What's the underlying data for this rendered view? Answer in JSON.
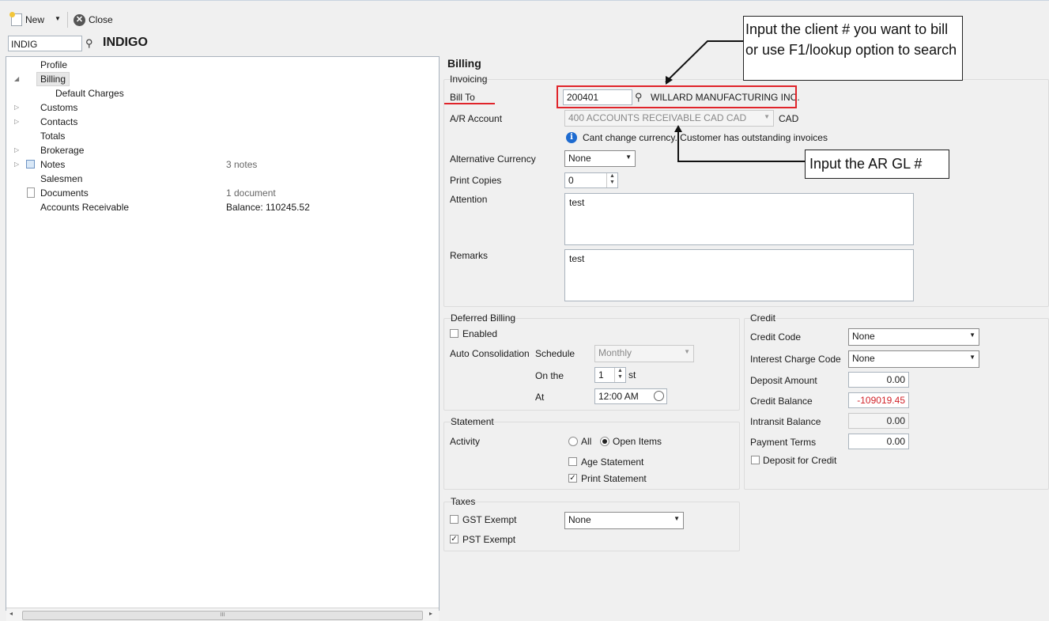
{
  "toolbar": {
    "new_label": "New",
    "close_label": "Close"
  },
  "search": {
    "value": "INDIG"
  },
  "record_title": "INDIGO",
  "tree": {
    "items": [
      {
        "label": "Profile",
        "value": ""
      },
      {
        "label": "Billing",
        "value": ""
      },
      {
        "label": "Default Charges",
        "value": ""
      },
      {
        "label": "Customs",
        "value": ""
      },
      {
        "label": "Contacts",
        "value": ""
      },
      {
        "label": "Totals",
        "value": ""
      },
      {
        "label": "Brokerage",
        "value": ""
      },
      {
        "label": "Notes",
        "value": "3 notes"
      },
      {
        "label": "Salesmen",
        "value": ""
      },
      {
        "label": "Documents",
        "value": "1 document"
      },
      {
        "label": "Accounts Receivable",
        "value": "Balance: 110245.52"
      }
    ]
  },
  "billing": {
    "heading": "Billing",
    "invoicing": {
      "title": "Invoicing",
      "bill_to_label": "Bill To",
      "bill_to_value": "200401",
      "bill_to_name": "WILLARD MANUFACTURING INC.",
      "ar_account_label": "A/R Account",
      "ar_account_value": "400 ACCOUNTS RECEIVABLE CAD CAD",
      "ar_currency": "CAD",
      "info_message": "Cant change currency. Customer has outstanding invoices",
      "alt_currency_label": "Alternative Currency",
      "alt_currency_value": "None",
      "print_copies_label": "Print Copies",
      "print_copies_value": "0",
      "attention_label": "Attention",
      "attention_value": "test",
      "remarks_label": "Remarks",
      "remarks_value": "test"
    },
    "deferred": {
      "title": "Deferred Billing",
      "enabled_label": "Enabled",
      "auto_label": "Auto Consolidation",
      "schedule_label": "Schedule",
      "schedule_value": "Monthly",
      "on_the_label": "On the",
      "on_the_value": "1",
      "on_the_suffix": "st",
      "at_label": "At",
      "at_value": "12:00 AM"
    },
    "statement": {
      "title": "Statement",
      "activity_label": "Activity",
      "all_label": "All",
      "open_items_label": "Open Items",
      "age_label": "Age Statement",
      "print_label": "Print Statement"
    },
    "taxes": {
      "title": "Taxes",
      "gst_label": "GST Exempt",
      "gst_value": "None",
      "pst_label": "PST Exempt"
    },
    "credit": {
      "title": "Credit",
      "credit_code_label": "Credit Code",
      "credit_code_value": "None",
      "interest_label": "Interest Charge Code",
      "interest_value": "None",
      "deposit_label": "Deposit Amount",
      "deposit_value": "0.00",
      "balance_label": "Credit Balance",
      "balance_value": "-109019.45",
      "intransit_label": "Intransit Balance",
      "intransit_value": "0.00",
      "terms_label": "Payment Terms",
      "terms_value": "0.00",
      "deposit_credit_label": "Deposit for Credit"
    }
  },
  "annotations": {
    "callout_client": "Input the client # you want to bill or use F1/lookup option to search",
    "callout_ar": "Input the AR GL #"
  },
  "colors": {
    "highlight_red": "#e0242a",
    "negative_red": "#d2232a",
    "info_blue": "#1e6bd0"
  }
}
